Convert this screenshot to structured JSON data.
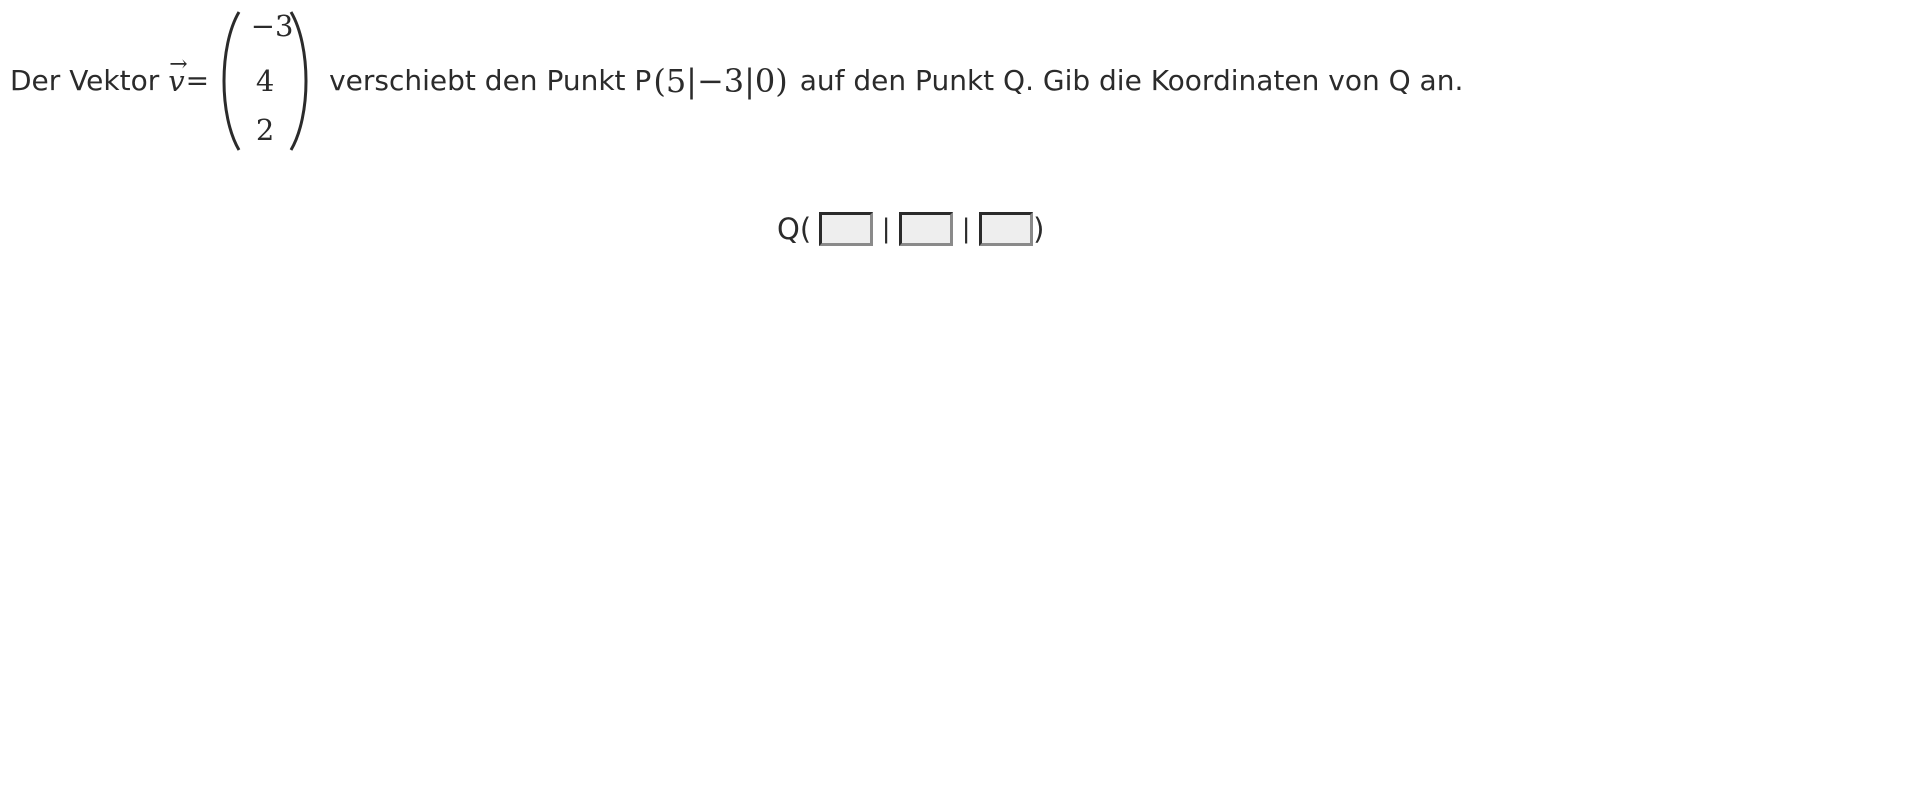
{
  "task": {
    "before_vector": "Der Vektor",
    "vector_letter": "v",
    "vector_arrow": "⃗",
    "equals": "=",
    "vector_components": [
      "−3",
      "4",
      "2"
    ],
    "text_before_point": "verschiebt den Punkt P",
    "point_coordinates": "(5|−3|0)",
    "text_after_point": "auf den Punkt Q. Gib die Koordinaten von Q an."
  },
  "answer": {
    "prefix": "Q(",
    "separator": "|",
    "suffix": ")",
    "fields": [
      {
        "value": "",
        "placeholder": ""
      },
      {
        "value": "",
        "placeholder": ""
      },
      {
        "value": "",
        "placeholder": ""
      }
    ]
  }
}
